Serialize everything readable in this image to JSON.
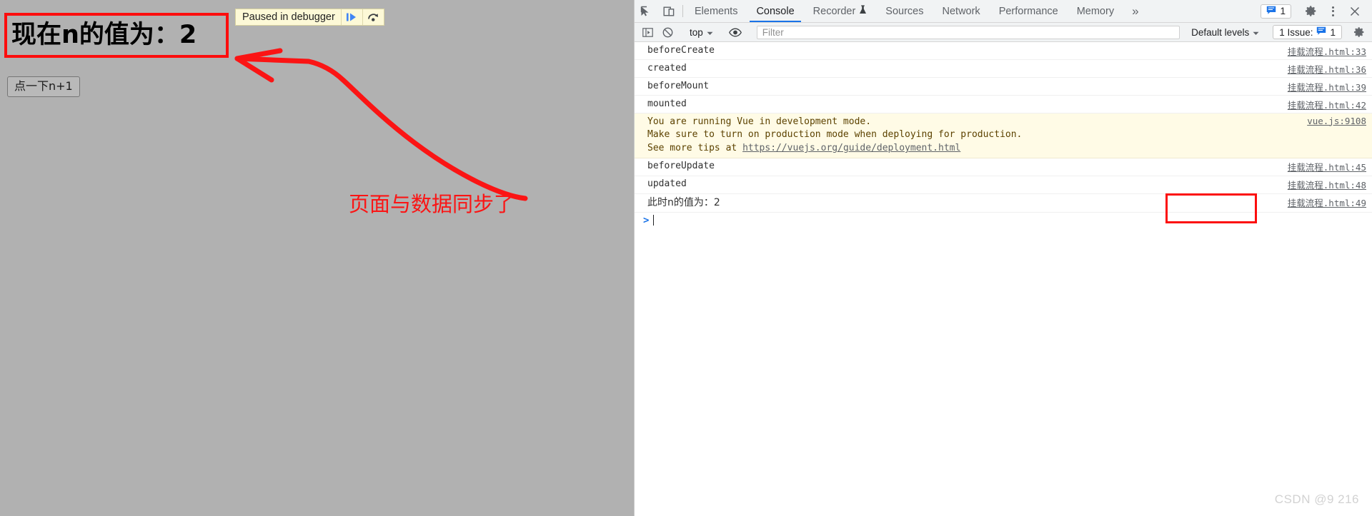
{
  "page": {
    "heading": "现在n的值为：2",
    "button_label": "点一下n+1",
    "annotation": "页面与数据同步了",
    "highlight_color": "#fc0d0d",
    "background_color": "#b1b1b1"
  },
  "paused_bar": {
    "label": "Paused in debugger",
    "resume_icon": "resume-script-icon",
    "step_over_icon": "step-over-icon",
    "background_color": "#fdf9d7"
  },
  "devtools": {
    "toolbar_icons": {
      "inspect": "inspect-element-icon",
      "device": "device-toolbar-icon"
    },
    "tabs": [
      {
        "label": "Elements",
        "active": false
      },
      {
        "label": "Console",
        "active": true
      },
      {
        "label": "Recorder",
        "active": false,
        "badge_icon": "flask-icon"
      },
      {
        "label": "Sources",
        "active": false
      },
      {
        "label": "Network",
        "active": false
      },
      {
        "label": "Performance",
        "active": false
      },
      {
        "label": "Memory",
        "active": false
      }
    ],
    "overflow_label": "»",
    "issues_badge": {
      "icon": "issue-message-icon",
      "count": "1"
    },
    "settings_icon": "gear-icon",
    "more_icon": "kebab-menu-icon",
    "close_icon": "close-icon"
  },
  "console_toolbar": {
    "sidebar_icon": "console-sidebar-icon",
    "clear_icon": "clear-console-icon",
    "context": "top",
    "eye_icon": "live-expression-eye-icon",
    "filter_placeholder": "Filter",
    "filter_value": "",
    "levels": "Default levels",
    "issues_label": "1 Issue:",
    "issues_count": "1",
    "issues_icon": "issue-message-icon",
    "settings_icon": "gear-icon"
  },
  "console_log": {
    "entries": [
      {
        "text": "beforeCreate",
        "source": "挂载流程.html:33",
        "level": "log"
      },
      {
        "text": "created",
        "source": "挂载流程.html:36",
        "level": "log"
      },
      {
        "text": "beforeMount",
        "source": "挂载流程.html:39",
        "level": "log"
      },
      {
        "text": "mounted",
        "source": "挂载流程.html:42",
        "level": "log"
      },
      {
        "text": "You are running Vue in development mode.\nMake sure to turn on production mode when deploying for production.\nSee more tips at ",
        "link": "https://vuejs.org/guide/deployment.html",
        "source": "vue.js:9108",
        "level": "warn"
      },
      {
        "text": "beforeUpdate",
        "source": "挂载流程.html:45",
        "level": "log"
      },
      {
        "text": "updated",
        "source": "挂载流程.html:48",
        "level": "log"
      },
      {
        "text": "此时n的值为：2",
        "source": "挂载流程.html:49",
        "level": "log",
        "cjk": true
      }
    ],
    "prompt_caret": ">"
  },
  "watermark": "CSDN @9 216"
}
